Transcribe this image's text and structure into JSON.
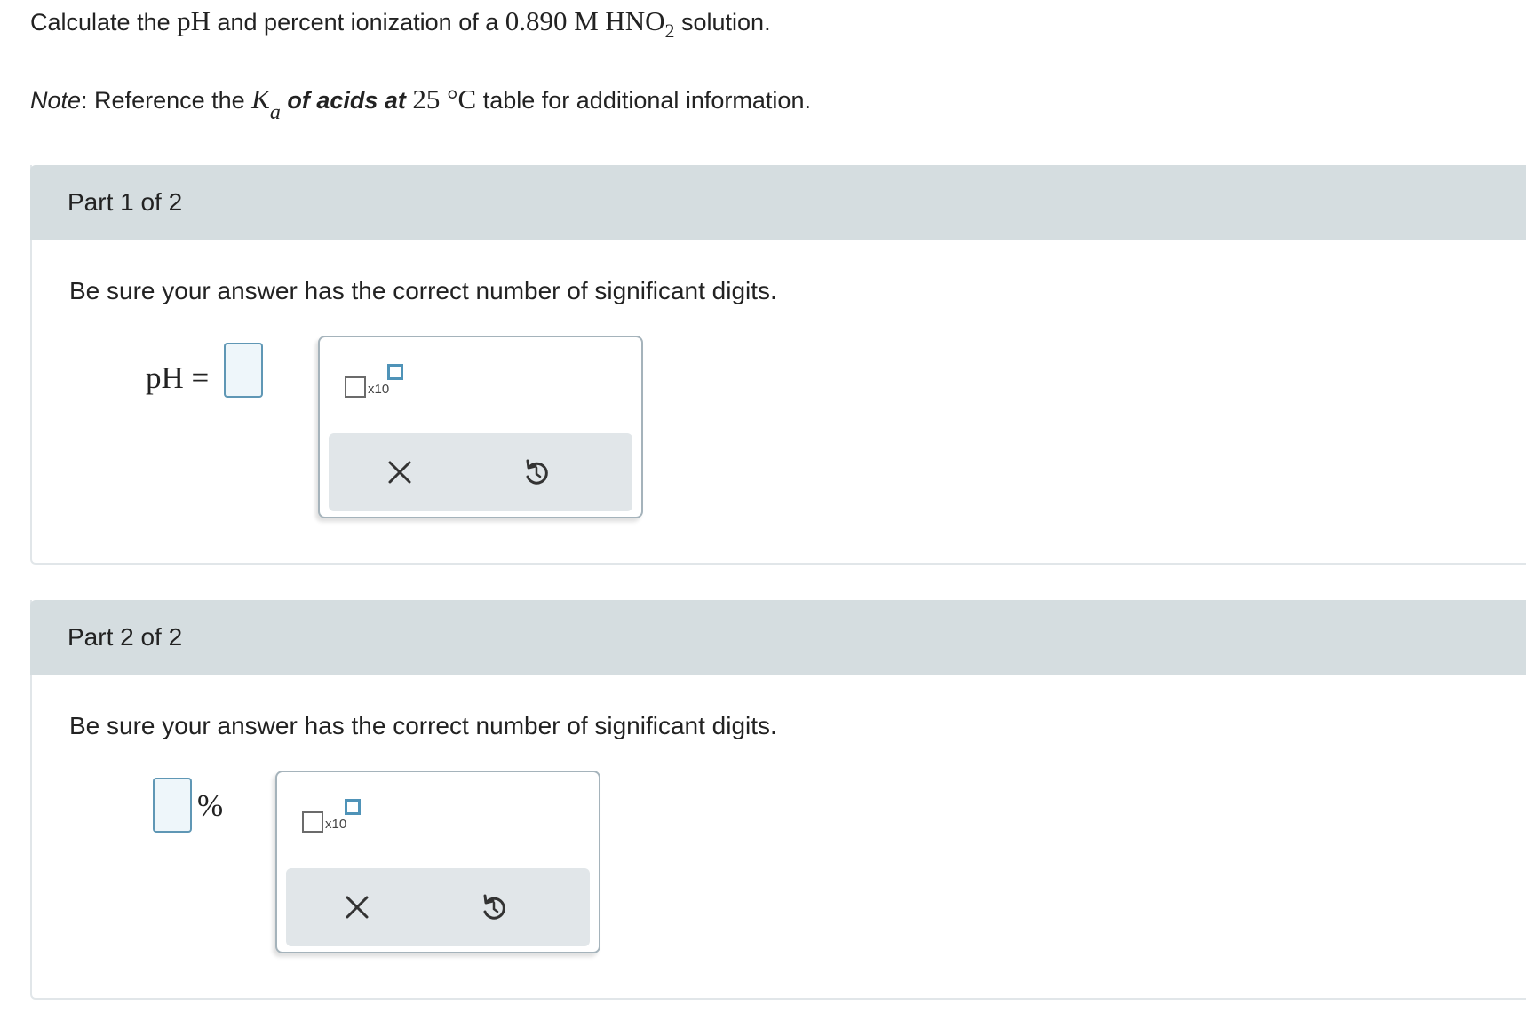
{
  "question": {
    "prefix": "Calculate the ",
    "ph_symbol": "pH",
    "middle": " and percent ionization of a ",
    "concentration": "0.890 M",
    "acid_formula": "HNO",
    "acid_subscript": "2",
    "suffix": " solution."
  },
  "note": {
    "label": "Note",
    "colon_text": ": Reference the ",
    "ka_symbol": "K",
    "ka_subscript": "a",
    "bold_text": " of acids at ",
    "temperature": "25 °C",
    "suffix": " table for additional information."
  },
  "parts": [
    {
      "title": "Part 1 of 2",
      "instruction": "Be sure your answer has the correct number of significant digits.",
      "answer_label": "pH =",
      "answer_value": "",
      "palette": {
        "sci_label": "x10",
        "clear_icon": "close-icon",
        "undo_icon": "undo-icon"
      }
    },
    {
      "title": "Part 2 of 2",
      "instruction": "Be sure your answer has the correct number of significant digits.",
      "answer_unit": "%",
      "answer_value": "",
      "palette": {
        "sci_label": "x10",
        "clear_icon": "close-icon",
        "undo_icon": "undo-icon"
      }
    }
  ],
  "colors": {
    "part_header": "#d5dde0",
    "answer_border": "#5f97b5",
    "answer_fill": "#eef6fa",
    "tray": "#e1e6e9"
  }
}
